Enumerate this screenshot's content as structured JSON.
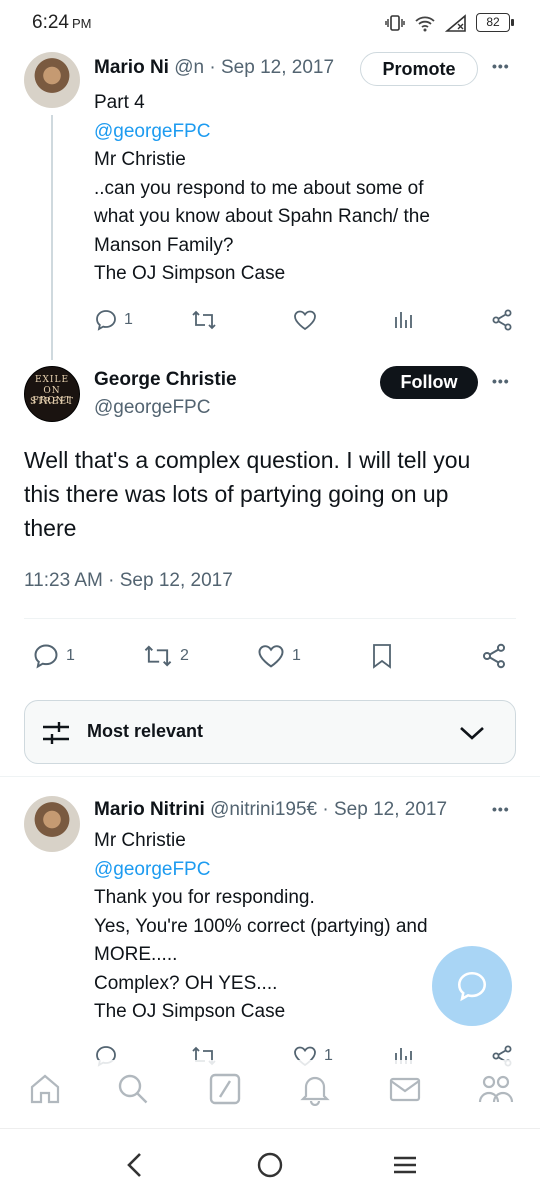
{
  "status_bar": {
    "time": "6:24",
    "ampm": "PM",
    "battery": "82"
  },
  "tweet1": {
    "name": "Mario Ni",
    "handle": "@n",
    "sep": "·",
    "date": "Sep 12, 2017",
    "promote_label": "Promote",
    "more": "•••",
    "lines": {
      "l1": "Part 4",
      "l2": "@georgeFPC",
      "l3": "Mr Christie",
      "l4": "..can you respond to me about some of",
      "l5": "what you know about Spahn Ranch/ the",
      "l6": "Manson Family?",
      "l7": "The OJ Simpson Case"
    },
    "reply_count": "1"
  },
  "tweet2": {
    "avatar_text": {
      "a": "EXILE",
      "b": "ON FRONT",
      "c": "STREET"
    },
    "name": "George Christie",
    "handle": "@georgeFPC",
    "follow_label": "Follow",
    "more": "•••",
    "lines": {
      "l1": "Well that's a complex question. I will tell you",
      "l2": "this there was lots of partying going on up",
      "l3": "there"
    },
    "timestamp": "11:23 AM · Sep 12, 2017",
    "reply_count": "1",
    "retweet_count": "2",
    "like_count": "1"
  },
  "sort": {
    "label": "Most relevant"
  },
  "tweet3": {
    "name": "Mario Nitrini",
    "handle": "@nitrini195€",
    "sep": "·",
    "date": "Sep 12, 2017",
    "more": "•••",
    "lines": {
      "l1": "Mr Christie",
      "l2": "@georgeFPC",
      "l3": "Thank you for responding.",
      "l4": "Yes, You're 100% correct (partying) and",
      "l5": "MORE.....",
      "l6": "Complex? OH YES....",
      "l7": "The OJ Simpson Case"
    },
    "like_count": "1"
  },
  "icons": {
    "reply": "reply-icon",
    "retweet": "retweet-icon",
    "like": "heart-icon",
    "views": "views-icon",
    "share": "share-icon",
    "bookmark": "bookmark-icon",
    "home": "home-icon",
    "search": "search-icon",
    "grok": "grok-icon",
    "notifications": "bell-icon",
    "messages": "mail-icon",
    "communities": "people-icon"
  },
  "colors": {
    "accent": "#1d9bf0",
    "text": "#0f1419",
    "muted": "#536471",
    "fab": "#a9d5f5"
  }
}
